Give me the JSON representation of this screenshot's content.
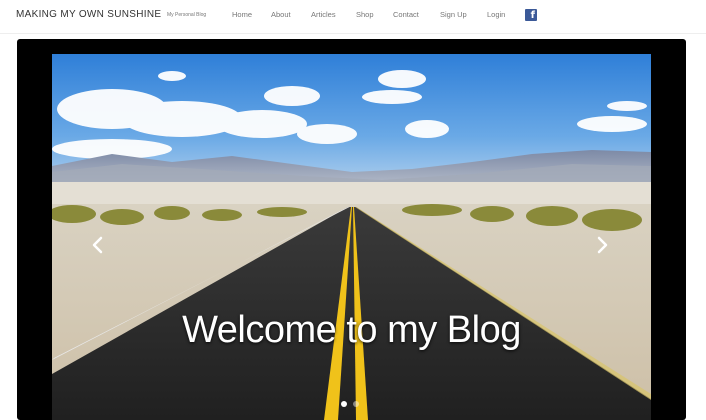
{
  "header": {
    "site_title": "MAKING MY OWN SUNSHINE",
    "tagline": "My Personal Blog",
    "nav": [
      {
        "label": "Home"
      },
      {
        "label": "About"
      },
      {
        "label": "Articles"
      },
      {
        "label": "Shop"
      },
      {
        "label": "Contact"
      },
      {
        "label": "Sign Up"
      },
      {
        "label": "Login"
      }
    ],
    "social_icon": "facebook-icon",
    "social_color": "#3b5998"
  },
  "hero": {
    "caption": "Welcome to my Blog",
    "prev_icon": "chevron-left-icon",
    "next_icon": "chevron-right-icon",
    "slide_count": 2,
    "active_slide": 1
  }
}
